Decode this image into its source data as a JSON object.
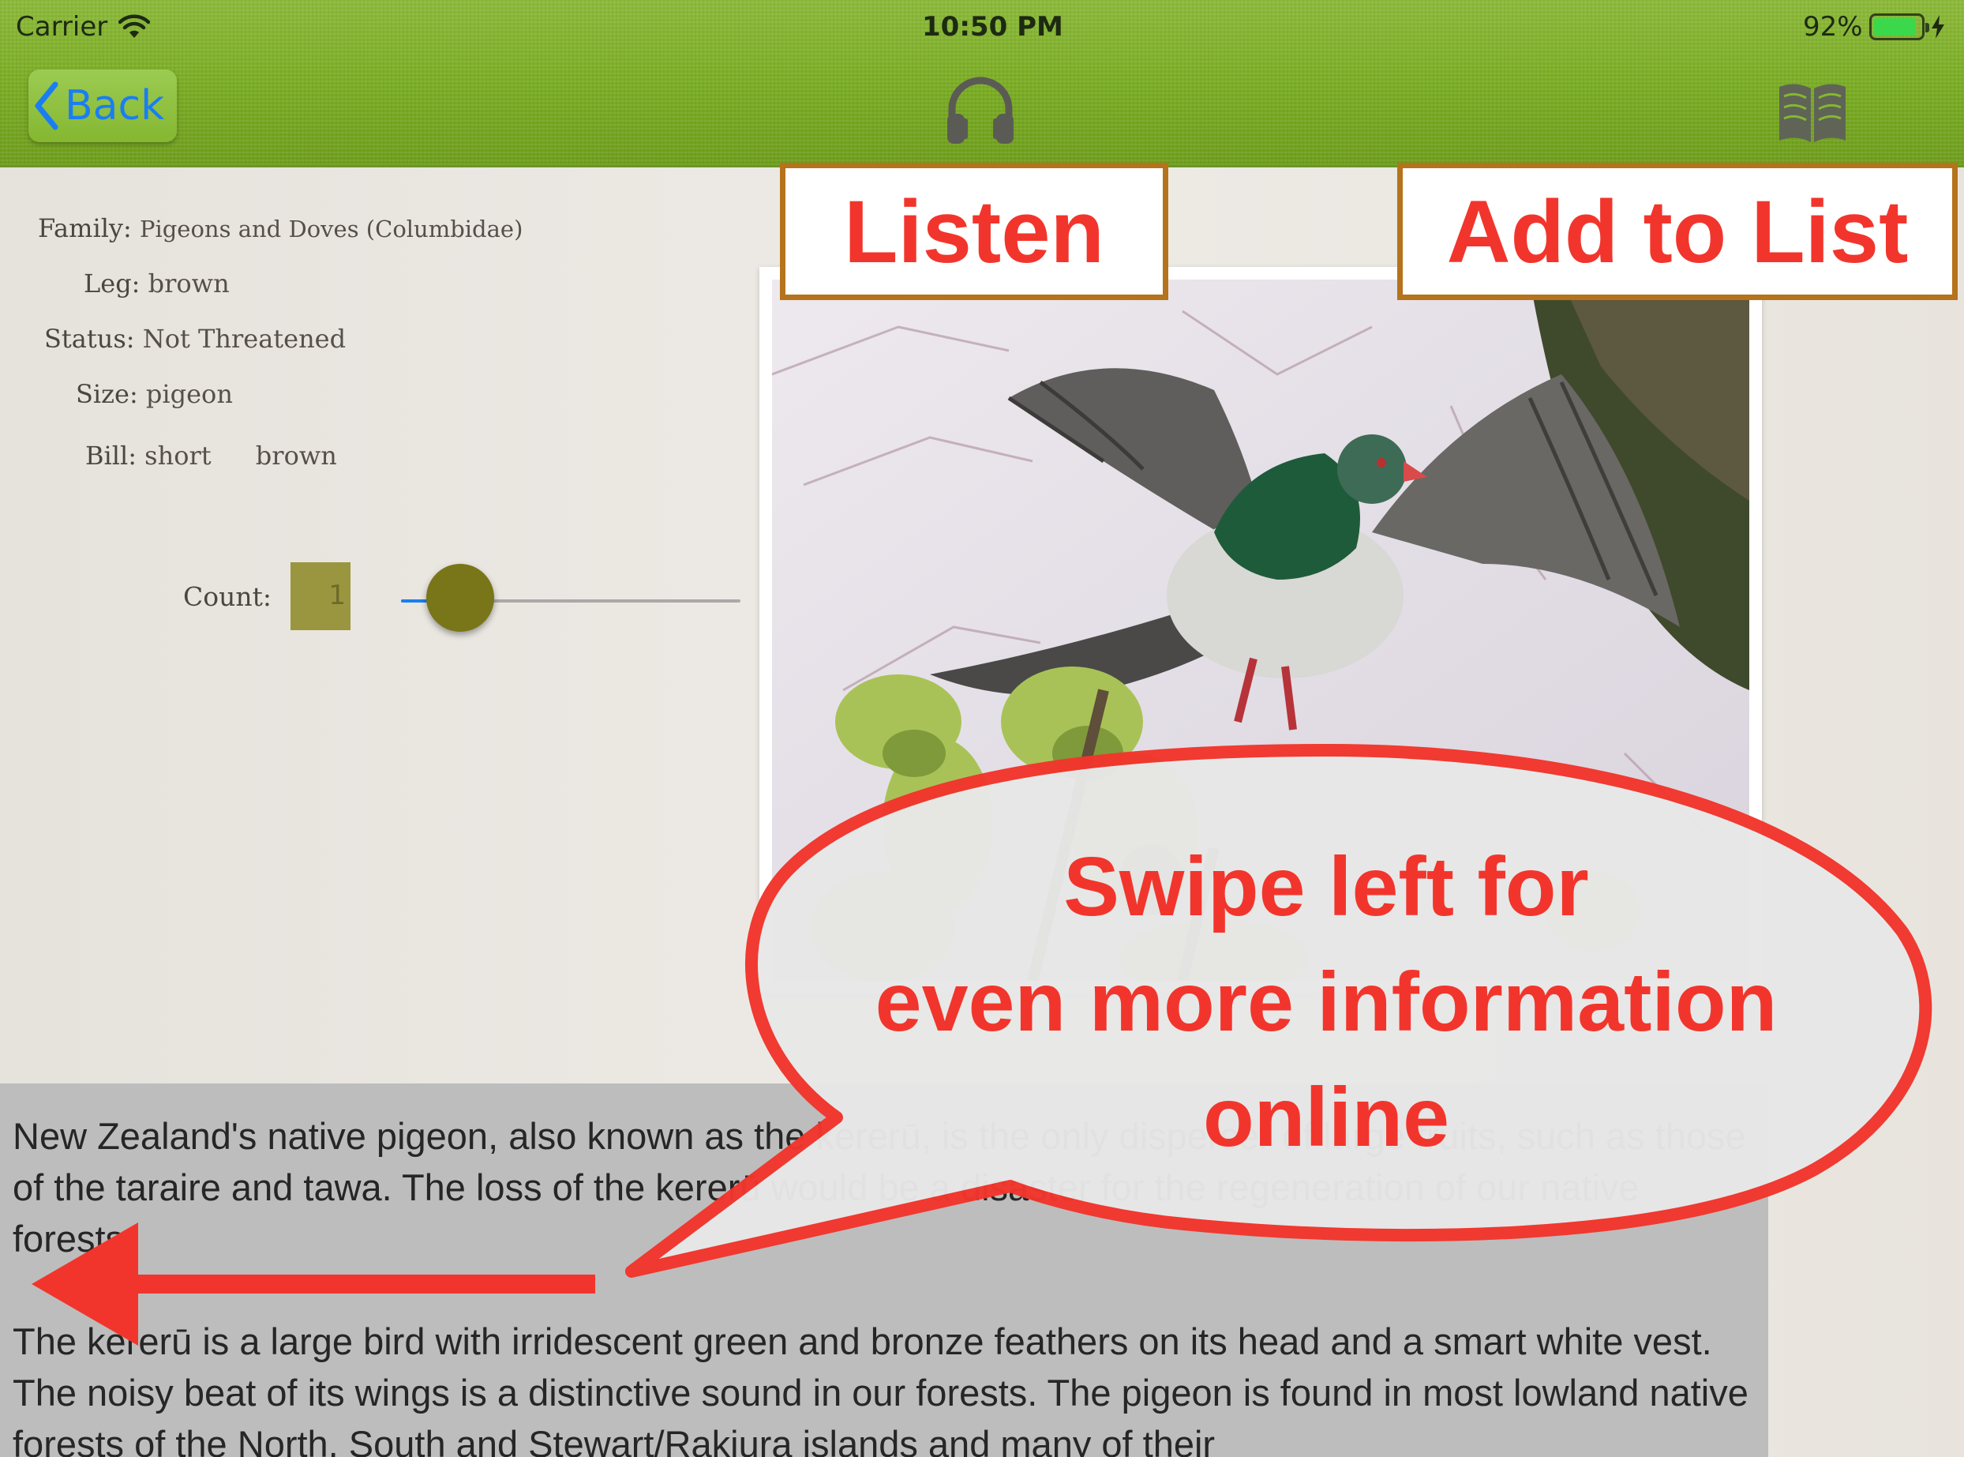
{
  "status_bar": {
    "carrier": "Carrier",
    "time": "10:50 PM",
    "battery": "92%",
    "battery_level": 0.92
  },
  "nav": {
    "back_label": "Back",
    "listen_icon": "headphones-icon",
    "add_icon": "book-icon"
  },
  "bird": {
    "family_label": "Family:",
    "family": "Pigeons and Doves (Columbidae)",
    "leg_label": "Leg:",
    "leg": "brown",
    "status_label": "Status:",
    "status": "Not Threatened",
    "size_label": "Size:",
    "size": "pigeon",
    "bill_label": "Bill:",
    "bill_1": "short",
    "bill_2": "brown"
  },
  "count": {
    "label": "Count:",
    "value": "1",
    "slider_fraction": 0.12
  },
  "description": {
    "paragraph_1": "New Zealand's native pigeon, also known as the kererū, is the only disperser of large fruits, such as those of the taraire and tawa. The loss of the kererū would be a disaster for the regeneration of our native forests.",
    "paragraph_2": "The kererū is a large bird with irridescent green and bronze feathers on its head and a smart white vest. The noisy beat of its wings is a distinctive sound in our forests. The pigeon is found in most lowland native forests of the North, South and Stewart/Rakiura islands and many of their"
  },
  "annotations": {
    "listen": "Listen",
    "add_to_list": "Add to List",
    "swipe_line_1": "Swipe left for",
    "swipe_line_2": "even more information",
    "swipe_line_3": "online"
  },
  "colors": {
    "nav_green": "#7aac24",
    "ios_blue": "#1a7ef2",
    "annotation_red": "#f2352c",
    "callout_border": "#b5731b",
    "count_olive": "#9a963f"
  }
}
